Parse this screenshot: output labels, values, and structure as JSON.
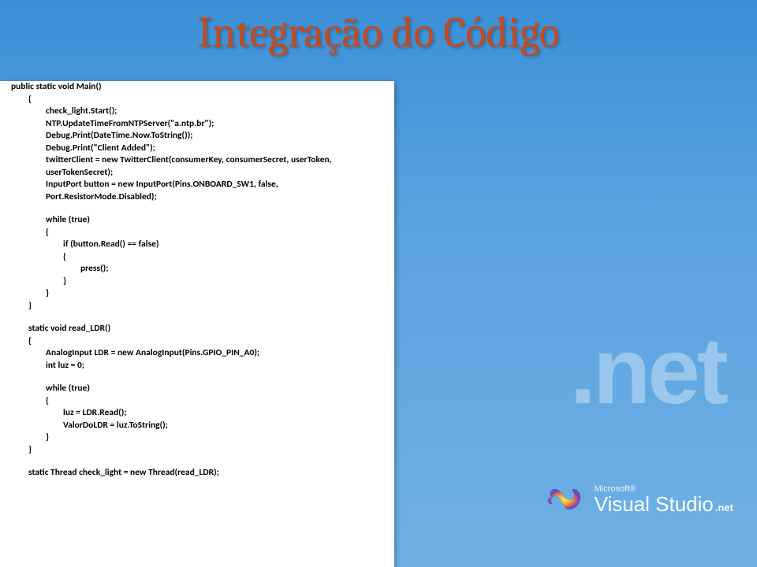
{
  "title": "Integração do Código",
  "watermark": ".net",
  "logo": {
    "ms": "Microsoft®",
    "product": "Visual Studio",
    "suffix": ".net"
  },
  "code": {
    "l0": "public static void Main()",
    "l1": "{",
    "l2": "check_light.Start();",
    "l3": "NTP.UpdateTimeFromNTPServer(\"a.ntp.br\");",
    "l4": "Debug.Print(DateTime.Now.ToString());",
    "l5": "Debug.Print(\"Client Added\");",
    "l6": "twitterClient = new TwitterClient(consumerKey, consumerSecret, userToken, userTokenSecret);",
    "l7": "InputPort button = new InputPort(Pins.ONBOARD_SW1, false, Port.ResistorMode.Disabled);",
    "l8": "while (true)",
    "l9": "{",
    "l10": "if (button.Read() == false)",
    "l11": "{",
    "l12": "press();",
    "l13": "}",
    "l14": "}",
    "l15": "}",
    "l16": "static void read_LDR()",
    "l17": "{",
    "l18": "AnalogInput LDR = new AnalogInput(Pins.GPIO_PIN_A0);",
    "l19": "int luz = 0;",
    "l20": "while (true)",
    "l21": "{",
    "l22": "luz = LDR.Read();",
    "l23": "ValorDoLDR = luz.ToString();",
    "l24": "}",
    "l25": "}",
    "l26": "static Thread check_light = new Thread(read_LDR);"
  }
}
